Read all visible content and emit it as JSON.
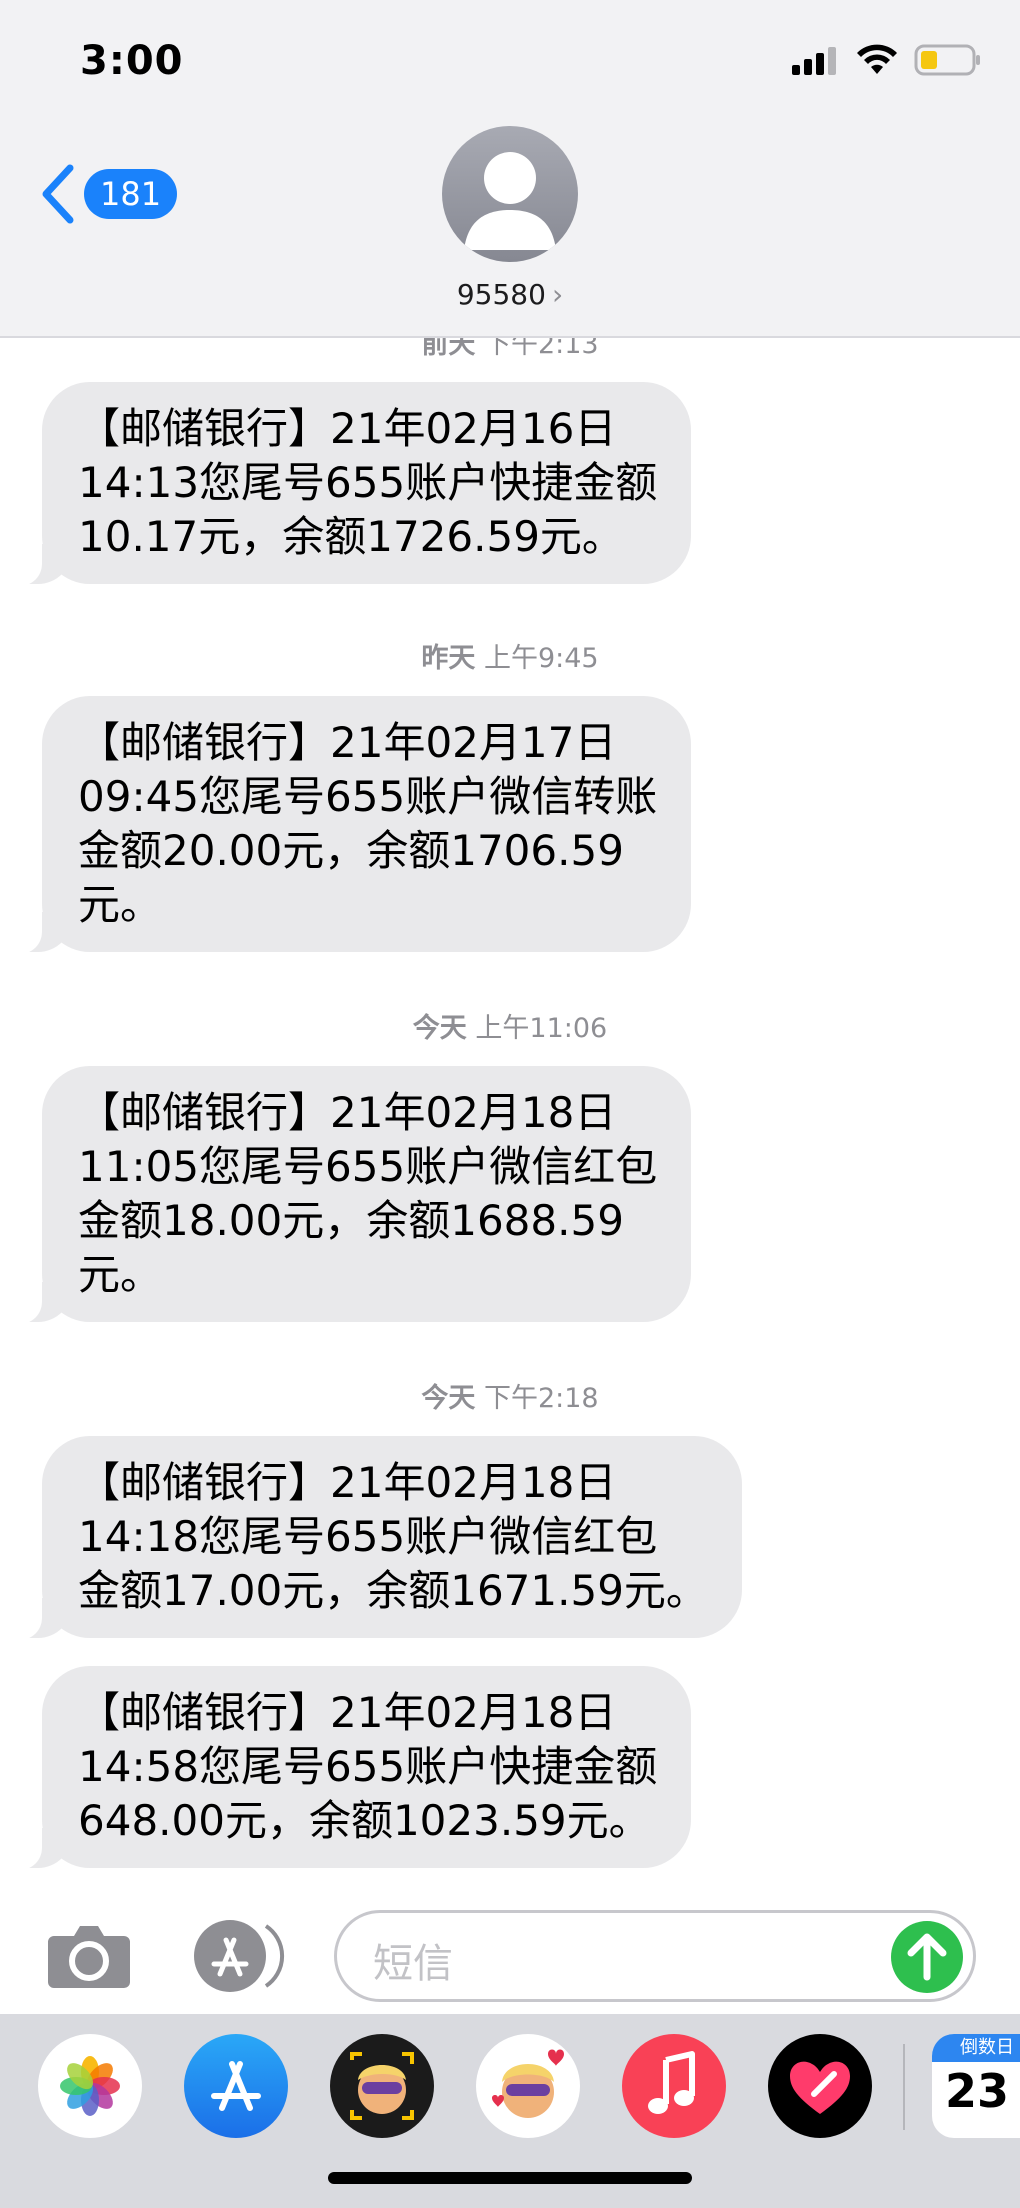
{
  "status_bar": {
    "time": "3:00"
  },
  "header": {
    "back_count": "181",
    "contact": "95580",
    "contact_chevron": "›"
  },
  "messages": [
    {
      "timestamp_day": "前天",
      "timestamp_time": "下午2:13",
      "text": "【邮储银行】21年02月16日\n14:13您尾号655账户快捷金额\n10.17元，余额1726.59元。"
    },
    {
      "timestamp_day": "昨天",
      "timestamp_time": "上午9:45",
      "text": "【邮储银行】21年02月17日\n09:45您尾号655账户微信转账\n金额20.00元，余额1706.59\n元。"
    },
    {
      "timestamp_day": "今天",
      "timestamp_time": "上午11:06",
      "text": "【邮储银行】21年02月18日\n11:05您尾号655账户微信红包\n金额18.00元，余额1688.59\n元。"
    },
    {
      "timestamp_day": "今天",
      "timestamp_time": "下午2:18",
      "text": "【邮储银行】21年02月18日\n14:18您尾号655账户微信红包\n金额17.00元，余额1671.59元。"
    },
    {
      "text": "【邮储银行】21年02月18日\n14:58您尾号655账户快捷金额\n648.00元，余额1023.59元。"
    }
  ],
  "input": {
    "placeholder": "短信"
  },
  "tray": {
    "apps": [
      "photos-icon",
      "app-store-icon",
      "memoji-camera-icon",
      "memoji-stickers-icon",
      "music-icon",
      "digital-touch-icon",
      "countdown-icon"
    ],
    "countdown_label": "倒数日",
    "countdown_number": "23"
  },
  "colors": {
    "accent": "#1a82fb",
    "send": "#2ebf4e",
    "bubble": "#e9e9eb",
    "music": "#f94156"
  }
}
